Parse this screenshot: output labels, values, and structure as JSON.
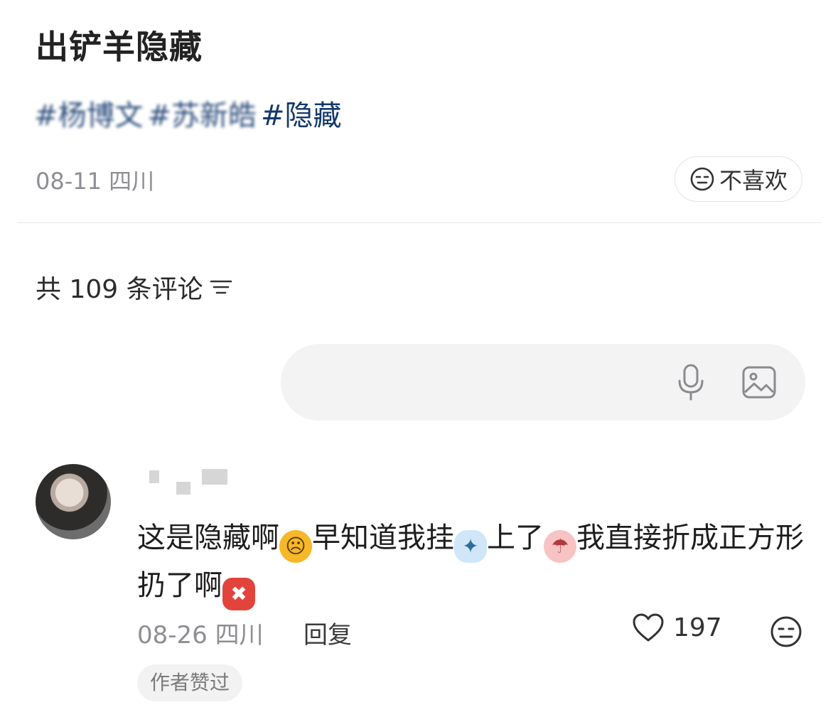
{
  "post": {
    "title": "出铲羊隐藏",
    "tags": [
      "#杨博文",
      "#苏新皓",
      "#隐藏"
    ],
    "date_location": "08-11 四川",
    "dislike_label": "不喜欢"
  },
  "comments_header": {
    "count_text": "共 109 条评论"
  },
  "comment_input": {
    "placeholder": ""
  },
  "comment": {
    "text_1": "这是隐藏啊",
    "text_2": "早知道我挂",
    "text_3": "上了",
    "text_4": "我直接折成正方形扔了啊",
    "date_location": "08-26 四川",
    "reply_label": "回复",
    "like_count": "197",
    "badge": "作者赞过"
  },
  "icons": {
    "dislike": "neutral-face-icon",
    "sort": "sort-filter-icon",
    "mic": "microphone-icon",
    "image": "image-icon",
    "like": "heart-icon"
  },
  "colors": {
    "tag": "#13386c",
    "meta": "#8e8e93",
    "input_bg": "#f3f3f4"
  }
}
